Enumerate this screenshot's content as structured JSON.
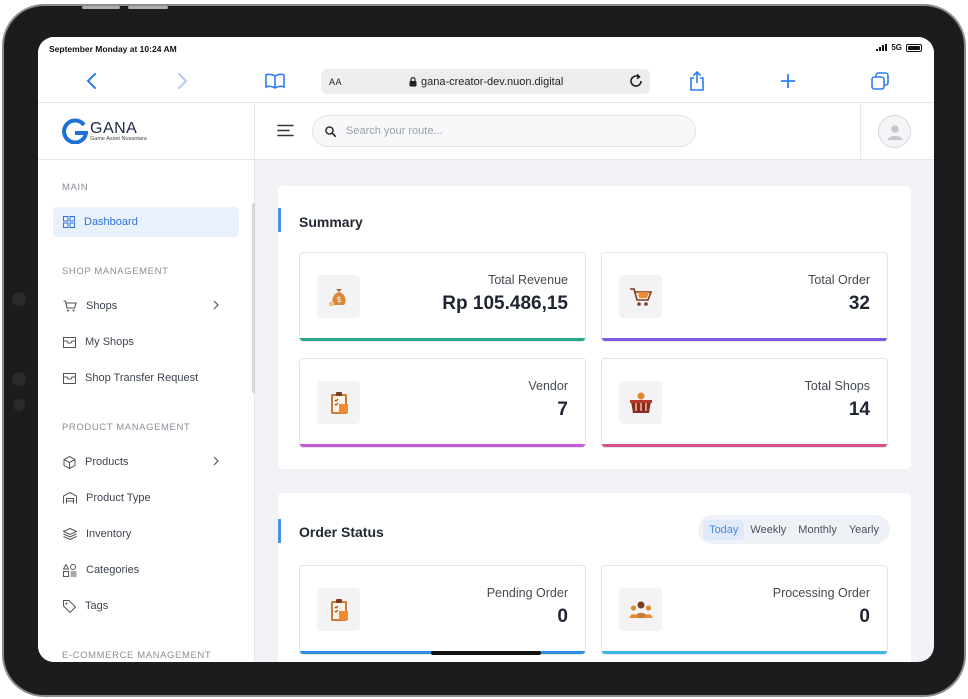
{
  "status_bar": {
    "time": "September Monday at 10:24 AM",
    "network": "5G"
  },
  "browser": {
    "text_size_label": "AA",
    "url": "gana-creator-dev.nuon.digital"
  },
  "brand": {
    "name": "GANA",
    "tagline": "Game Asset Nusantara",
    "logo_letter": "G"
  },
  "search": {
    "placeholder": "Search your route..."
  },
  "sidebar": {
    "sections": [
      {
        "title": "MAIN",
        "items": [
          {
            "label": "Dashboard",
            "icon": "grid-icon",
            "active": true
          }
        ]
      },
      {
        "title": "SHOP MANAGEMENT",
        "items": [
          {
            "label": "Shops",
            "icon": "cart-icon",
            "has_children": true
          },
          {
            "label": "My Shops",
            "icon": "inbox-icon"
          },
          {
            "label": "Shop Transfer Request",
            "icon": "inbox-icon"
          }
        ]
      },
      {
        "title": "PRODUCT MANAGEMENT",
        "items": [
          {
            "label": "Products",
            "icon": "box-icon",
            "has_children": true
          },
          {
            "label": "Product Type",
            "icon": "warehouse-icon"
          },
          {
            "label": "Inventory",
            "icon": "layers-icon"
          },
          {
            "label": "Categories",
            "icon": "categories-icon"
          },
          {
            "label": "Tags",
            "icon": "tag-icon"
          }
        ]
      },
      {
        "title": "E-COMMERCE MANAGEMENT",
        "items": []
      }
    ]
  },
  "summary": {
    "title": "Summary",
    "cards": [
      {
        "label": "Total Revenue",
        "value": "Rp 105.486,15",
        "icon": "money-bag-icon",
        "color": "#26a98a"
      },
      {
        "label": "Total Order",
        "value": "32",
        "icon": "shopping-cart-icon",
        "color": "#7b5ce0"
      },
      {
        "label": "Vendor",
        "value": "7",
        "icon": "clipboard-icon",
        "color": "#c45ad8"
      },
      {
        "label": "Total Shops",
        "value": "14",
        "icon": "basket-icon",
        "color": "#d6508a"
      }
    ]
  },
  "order_status": {
    "title": "Order Status",
    "tabs": [
      "Today",
      "Weekly",
      "Monthly",
      "Yearly"
    ],
    "active_tab": "Today",
    "cards": [
      {
        "label": "Pending Order",
        "value": "0",
        "icon": "clipboard-icon",
        "color": "#2e8fe0"
      },
      {
        "label": "Processing Order",
        "value": "0",
        "icon": "people-icon",
        "color": "#3cb6e6"
      }
    ]
  }
}
